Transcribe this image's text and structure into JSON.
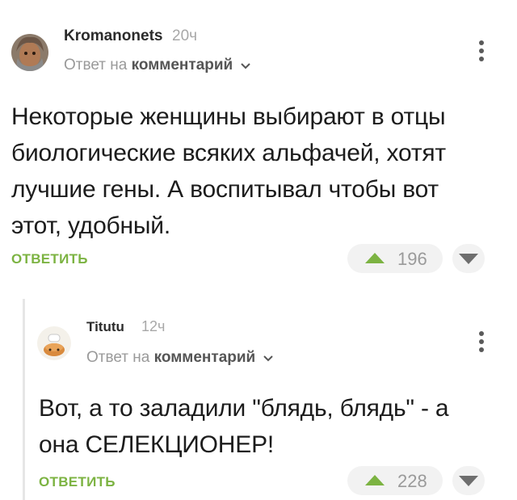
{
  "comments": [
    {
      "author": "Kromanonets",
      "time": "20ч",
      "reply_to_prefix": "Ответ на",
      "reply_to_target": "комментарий",
      "text_lines": [
        "Некоторые женщины выбирают в отцы",
        "биологические всяких альфачей, хотят",
        "лучшие гены. А воспитывал чтобы вот",
        "этот, удобный."
      ],
      "reply_label": "ОТВЕТИТЬ",
      "score": "196"
    },
    {
      "author": "Titutu",
      "time": "12ч",
      "reply_to_prefix": "Ответ на",
      "reply_to_target": "комментарий",
      "text_lines": [
        "Вот, а то заладили \"блядь, блядь\" - а",
        "она СЕЛЕКЦИОНЕР!"
      ],
      "reply_label": "ОТВЕТИТЬ",
      "score": "228"
    }
  ],
  "icons": {
    "more": "kebab-menu-icon",
    "upvote": "arrow-up-icon",
    "downvote": "arrow-down-icon",
    "expand": "chevron-down-icon"
  },
  "colors": {
    "accent": "#7cb342",
    "muted": "#9a9a9a",
    "pill": "#f2f2f2"
  }
}
